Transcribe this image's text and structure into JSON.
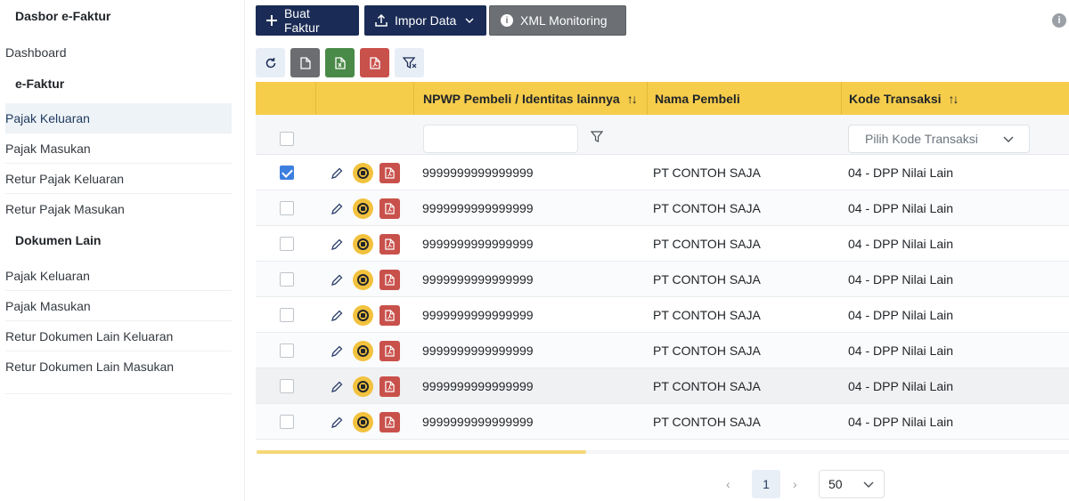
{
  "sidebar": {
    "title": "Dasbor e-Faktur",
    "dashboard": "Dashboard",
    "section_efaktur": "e-Faktur",
    "efaktur_items": [
      "Pajak Keluaran",
      "Pajak Masukan",
      "Retur Pajak Keluaran",
      "Retur Pajak Masukan"
    ],
    "section_dokumen": "Dokumen Lain",
    "dokumen_items": [
      "Pajak Keluaran",
      "Pajak Masukan",
      "Retur Dokumen Lain Keluaran",
      "Retur Dokumen Lain Masukan"
    ],
    "active_item": "Pajak Keluaran"
  },
  "toolbar": {
    "buat_faktur": "Buat Faktur",
    "impor_data": "Impor Data",
    "xml_monitoring": "XML Monitoring"
  },
  "icon_toolbar": {
    "icons": [
      "refresh-icon",
      "file-icon",
      "excel-icon",
      "pdf-icon",
      "filter-clear-icon"
    ]
  },
  "table": {
    "columns": {
      "npwp": "NPWP Pembeli / Identitas lainnya",
      "nama": "Nama Pembeli",
      "kode": "Kode Transaksi"
    },
    "filter": {
      "npwp_value": "",
      "kode_placeholder": "Pilih Kode Transaksi"
    },
    "rows": [
      {
        "checked": true,
        "npwp": "9999999999999999",
        "nama": "PT CONTOH SAJA",
        "kode": "04 - DPP Nilai Lain"
      },
      {
        "checked": false,
        "npwp": "9999999999999999",
        "nama": "PT CONTOH SAJA",
        "kode": "04 - DPP Nilai Lain"
      },
      {
        "checked": false,
        "npwp": "9999999999999999",
        "nama": "PT CONTOH SAJA",
        "kode": "04 - DPP Nilai Lain"
      },
      {
        "checked": false,
        "npwp": "9999999999999999",
        "nama": "PT CONTOH SAJA",
        "kode": "04 - DPP Nilai Lain"
      },
      {
        "checked": false,
        "npwp": "9999999999999999",
        "nama": "PT CONTOH SAJA",
        "kode": "04 - DPP Nilai Lain"
      },
      {
        "checked": false,
        "npwp": "9999999999999999",
        "nama": "PT CONTOH SAJA",
        "kode": "04 - DPP Nilai Lain"
      },
      {
        "checked": false,
        "npwp": "9999999999999999",
        "nama": "PT CONTOH SAJA",
        "kode": "04 - DPP Nilai Lain"
      },
      {
        "checked": false,
        "npwp": "9999999999999999",
        "nama": "PT CONTOH SAJA",
        "kode": "04 - DPP Nilai Lain"
      }
    ],
    "highlighted_row": 6
  },
  "pagination": {
    "current_page": "1",
    "page_size": "50"
  },
  "colors": {
    "primary": "#1a2b55",
    "header_yellow": "#f6cd4b",
    "excel_green": "#4a8a48",
    "pdf_red": "#c9514b",
    "checkbox_blue": "#3d7fe0"
  }
}
